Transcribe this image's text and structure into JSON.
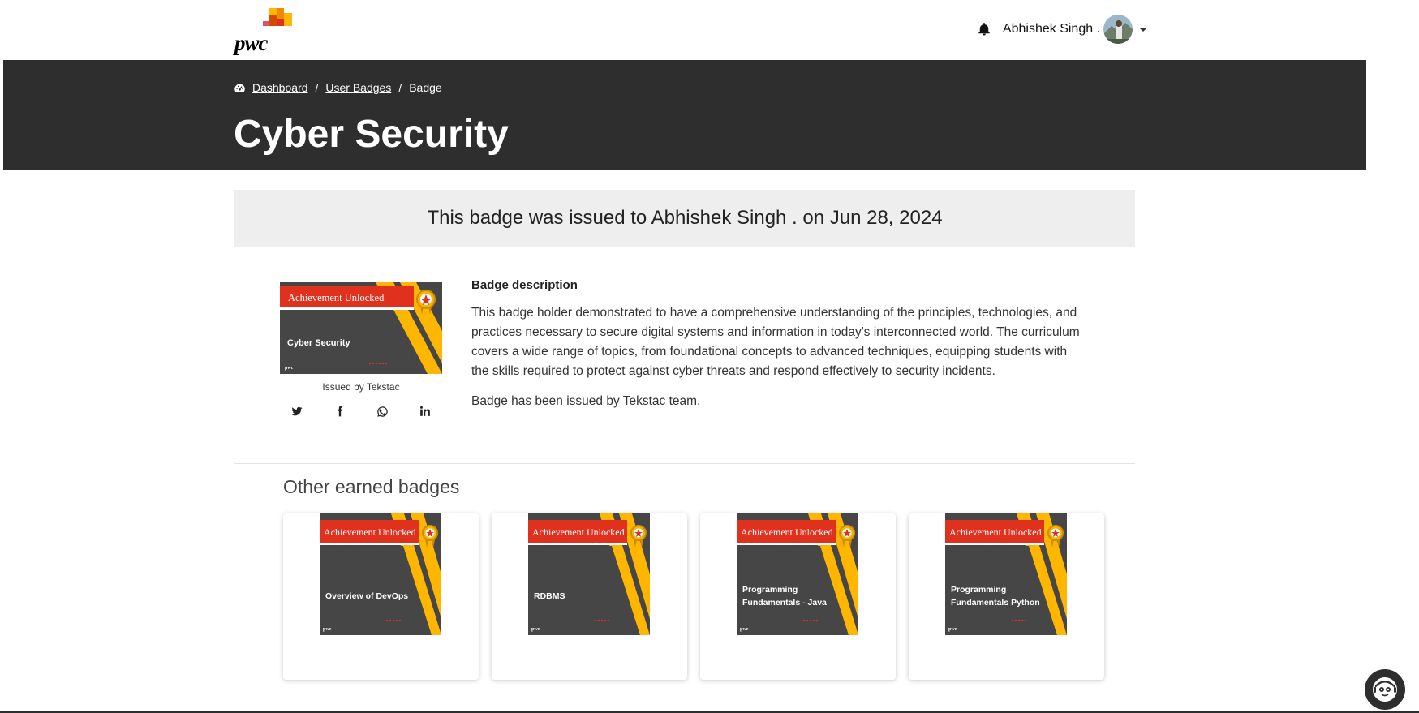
{
  "brand": {
    "logo_text": "pwc"
  },
  "user": {
    "name": "Abhishek Singh ."
  },
  "breadcrumb": {
    "items": [
      {
        "label": "Dashboard"
      },
      {
        "label": "User Badges"
      },
      {
        "label": "Badge"
      }
    ]
  },
  "page": {
    "title": "Cyber Security",
    "issued_banner": "This badge was issued to Abhishek Singh . on Jun 28, 2024"
  },
  "badge": {
    "ribbon_text": "Achievement Unlocked",
    "name": "Cyber Security",
    "issued_by": "Issued by Tekstac",
    "mini_logo": "pwc",
    "social_icons": [
      "twitter-icon",
      "facebook-icon",
      "whatsapp-icon",
      "linkedin-icon"
    ]
  },
  "description": {
    "heading": "Badge description",
    "text": "This badge holder demonstrated to have a comprehensive understanding of the principles, technologies, and practices necessary to secure digital systems and information in today's interconnected world. The curriculum covers a wide range of topics, from foundational concepts to advanced techniques, equipping students with the skills required to protect against cyber threats and respond effectively to security incidents.",
    "issuer_note": "Badge has been issued by Tekstac team."
  },
  "other_badges": {
    "title": "Other earned badges",
    "items": [
      {
        "ribbon": "Achievement Unlocked",
        "line1": "Overview of DevOps",
        "line2": ""
      },
      {
        "ribbon": "Achievement Unlocked",
        "line1": "RDBMS",
        "line2": ""
      },
      {
        "ribbon": "Achievement Unlocked",
        "line1": "Programming",
        "line2": "Fundamentals - Java"
      },
      {
        "ribbon": "Achievement Unlocked",
        "line1": "Programming",
        "line2": "Fundamentals Python"
      }
    ]
  },
  "colors": {
    "header_bg": "#2e2e2e",
    "banner_bg": "#eeeeee",
    "badge_red": "#e0301e",
    "badge_amber": "#ffb600",
    "badge_dark": "#464646"
  }
}
